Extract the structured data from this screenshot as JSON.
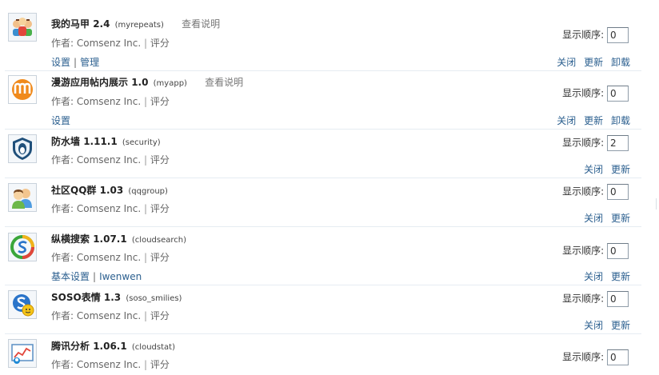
{
  "meta_prefix": "作者:",
  "score_label": "评分",
  "order_label": "显示顺序:",
  "plugins": [
    {
      "name": "我的马甲",
      "version": "2.4",
      "identifier": "(myrepeats)",
      "doc_link": "查看说明",
      "author": "Comsenz Inc.",
      "order": "0",
      "links": [
        "设置",
        "管理"
      ],
      "actions": [
        "关闭",
        "更新",
        "卸载"
      ],
      "icon": "people-group-icon"
    },
    {
      "name": "漫游应用帖内展示",
      "version": "1.0",
      "identifier": "(myapp)",
      "doc_link": "查看说明",
      "author": "Comsenz Inc.",
      "order": "0",
      "links": [
        "设置"
      ],
      "actions": [
        "关闭",
        "更新",
        "卸载"
      ],
      "icon": "manyou-m-icon"
    },
    {
      "name": "防水墙",
      "version": "1.11.1",
      "identifier": "(security)",
      "doc_link": "",
      "author": "Comsenz Inc.",
      "order": "2",
      "links": [],
      "actions": [
        "关闭",
        "更新"
      ],
      "icon": "shield-penguin-icon"
    },
    {
      "name": "社区QQ群",
      "version": "1.03",
      "identifier": "(qqgroup)",
      "doc_link": "",
      "author": "Comsenz Inc.",
      "order": "0",
      "links": [],
      "actions": [
        "关闭",
        "更新"
      ],
      "icon": "users-pair-icon"
    },
    {
      "name": "纵横搜索",
      "version": "1.07.1",
      "identifier": "(cloudsearch)",
      "doc_link": "",
      "author": "Comsenz Inc.",
      "order": "0",
      "links": [
        "基本设置",
        "Iwenwen"
      ],
      "actions": [
        "关闭",
        "更新"
      ],
      "icon": "soso-ring-icon"
    },
    {
      "name": "SOSO表情",
      "version": "1.3",
      "identifier": "(soso_smilies)",
      "doc_link": "",
      "author": "Comsenz Inc.",
      "order": "0",
      "links": [],
      "actions": [
        "关闭",
        "更新"
      ],
      "icon": "soso-smiley-icon"
    },
    {
      "name": "腾讯分析",
      "version": "1.06.1",
      "identifier": "(cloudstat)",
      "doc_link": "",
      "author": "Comsenz Inc.",
      "order": "0",
      "links": [],
      "actions": [],
      "icon": "analytics-chart-icon"
    }
  ]
}
